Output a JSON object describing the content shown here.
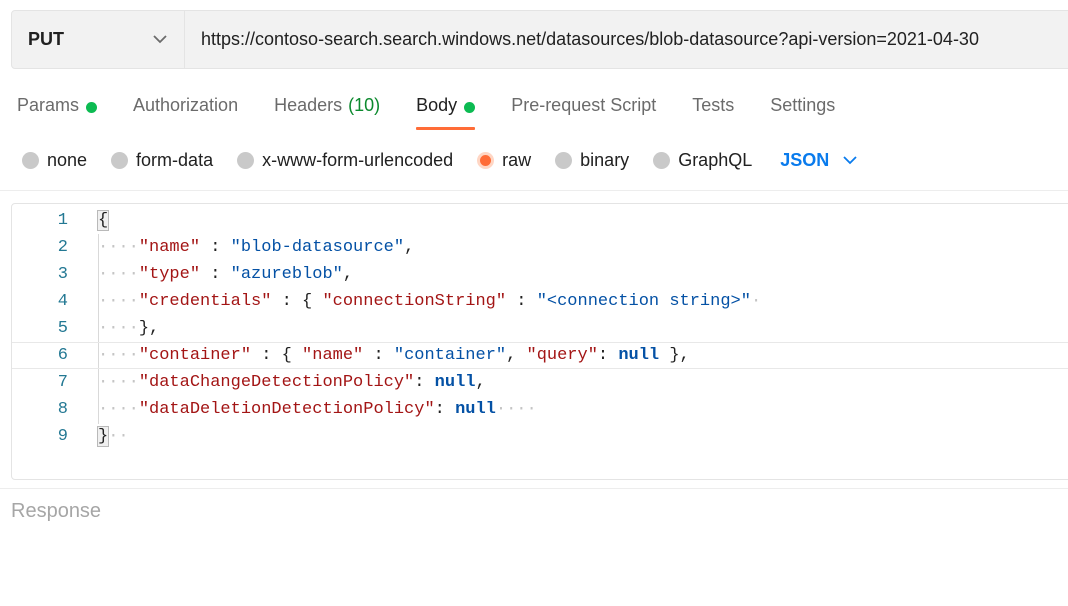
{
  "request": {
    "method": "PUT",
    "url": "https://contoso-search.search.windows.net/datasources/blob-datasource?api-version=2021-04-30"
  },
  "tabs": [
    {
      "label": "Params"
    },
    {
      "label": "Authorization"
    },
    {
      "label": "Headers",
      "count": "(10)"
    },
    {
      "label": "Body"
    },
    {
      "label": "Pre-request Script"
    },
    {
      "label": "Tests"
    },
    {
      "label": "Settings"
    }
  ],
  "body_types": [
    {
      "label": "none"
    },
    {
      "label": "form-data"
    },
    {
      "label": "x-www-form-urlencoded"
    },
    {
      "label": "raw"
    },
    {
      "label": "binary"
    },
    {
      "label": "GraphQL"
    }
  ],
  "format": "JSON",
  "editor": {
    "line_numbers": [
      "1",
      "2",
      "3",
      "4",
      "5",
      "6",
      "7",
      "8",
      "9"
    ],
    "l1": {
      "brace": "{"
    },
    "l2": {
      "key": "\"name\"",
      "sep": " : ",
      "value": "\"blob-datasource\"",
      "end": ","
    },
    "l3": {
      "key": "\"type\"",
      "sep": " : ",
      "value": "\"azureblob\"",
      "end": ","
    },
    "l4": {
      "key": "\"credentials\"",
      "sep": " : ",
      "open": "{ ",
      "key2": "\"connectionString\"",
      "sep2": " : ",
      "value": "\"<connection string>\""
    },
    "l5": {
      "close": "},"
    },
    "l6": {
      "key": "\"container\"",
      "sep": " : ",
      "open": "{ ",
      "key2": "\"name\"",
      "sep2": " : ",
      "value2": "\"container\"",
      "comma": ", ",
      "key3": "\"query\"",
      "sep3": ": ",
      "value3": "null",
      "close": " },"
    },
    "l7": {
      "key": "\"dataChangeDetectionPolicy\"",
      "sep": ": ",
      "value": "null",
      "end": ","
    },
    "l8": {
      "key": "\"dataDeletionDetectionPolicy\"",
      "sep": ": ",
      "value": "null"
    },
    "l9": {
      "brace": "}"
    }
  },
  "response_label": "Response",
  "colors": {
    "accent": "#ff6c37",
    "status_dot": "#0cbb52",
    "link_blue": "#097bed"
  }
}
